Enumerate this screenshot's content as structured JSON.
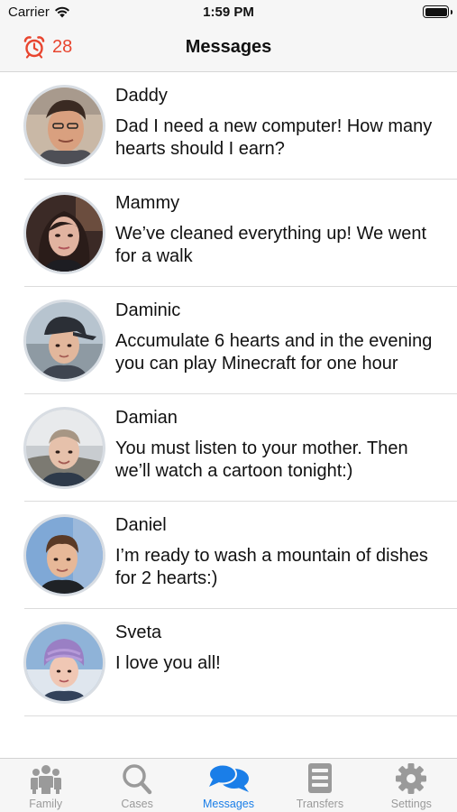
{
  "status_bar": {
    "carrier": "Carrier",
    "time": "1:59 PM"
  },
  "header": {
    "counter": "28",
    "title": "Messages"
  },
  "messages": [
    {
      "name": "Daddy",
      "text": "Dad I need a new computer! How many hearts should I earn?"
    },
    {
      "name": "Mammy",
      "text": "We’ve cleaned everything up! We went for a walk"
    },
    {
      "name": "Daminic",
      "text": "Accumulate 6 hearts and in the evening you can play Minecraft for one hour"
    },
    {
      "name": "Damian",
      "text": "You must listen to your mother. Then we’ll watch a cartoon tonight:)"
    },
    {
      "name": "Daniel",
      "text": "I’m ready to wash a mountain of dishes for 2 hearts:)"
    },
    {
      "name": "Sveta",
      "text": "I love you all!"
    }
  ],
  "tabs": [
    {
      "label": "Family",
      "icon": "family-icon"
    },
    {
      "label": "Cases",
      "icon": "search-icon"
    },
    {
      "label": "Messages",
      "icon": "chat-bubbles-icon",
      "active": true
    },
    {
      "label": "Transfers",
      "icon": "list-icon"
    },
    {
      "label": "Settings",
      "icon": "gear-icon"
    }
  ],
  "colors": {
    "accent": "#1a7ee8",
    "alarm": "#e8452f",
    "tab_inactive": "#9a9a9a"
  }
}
